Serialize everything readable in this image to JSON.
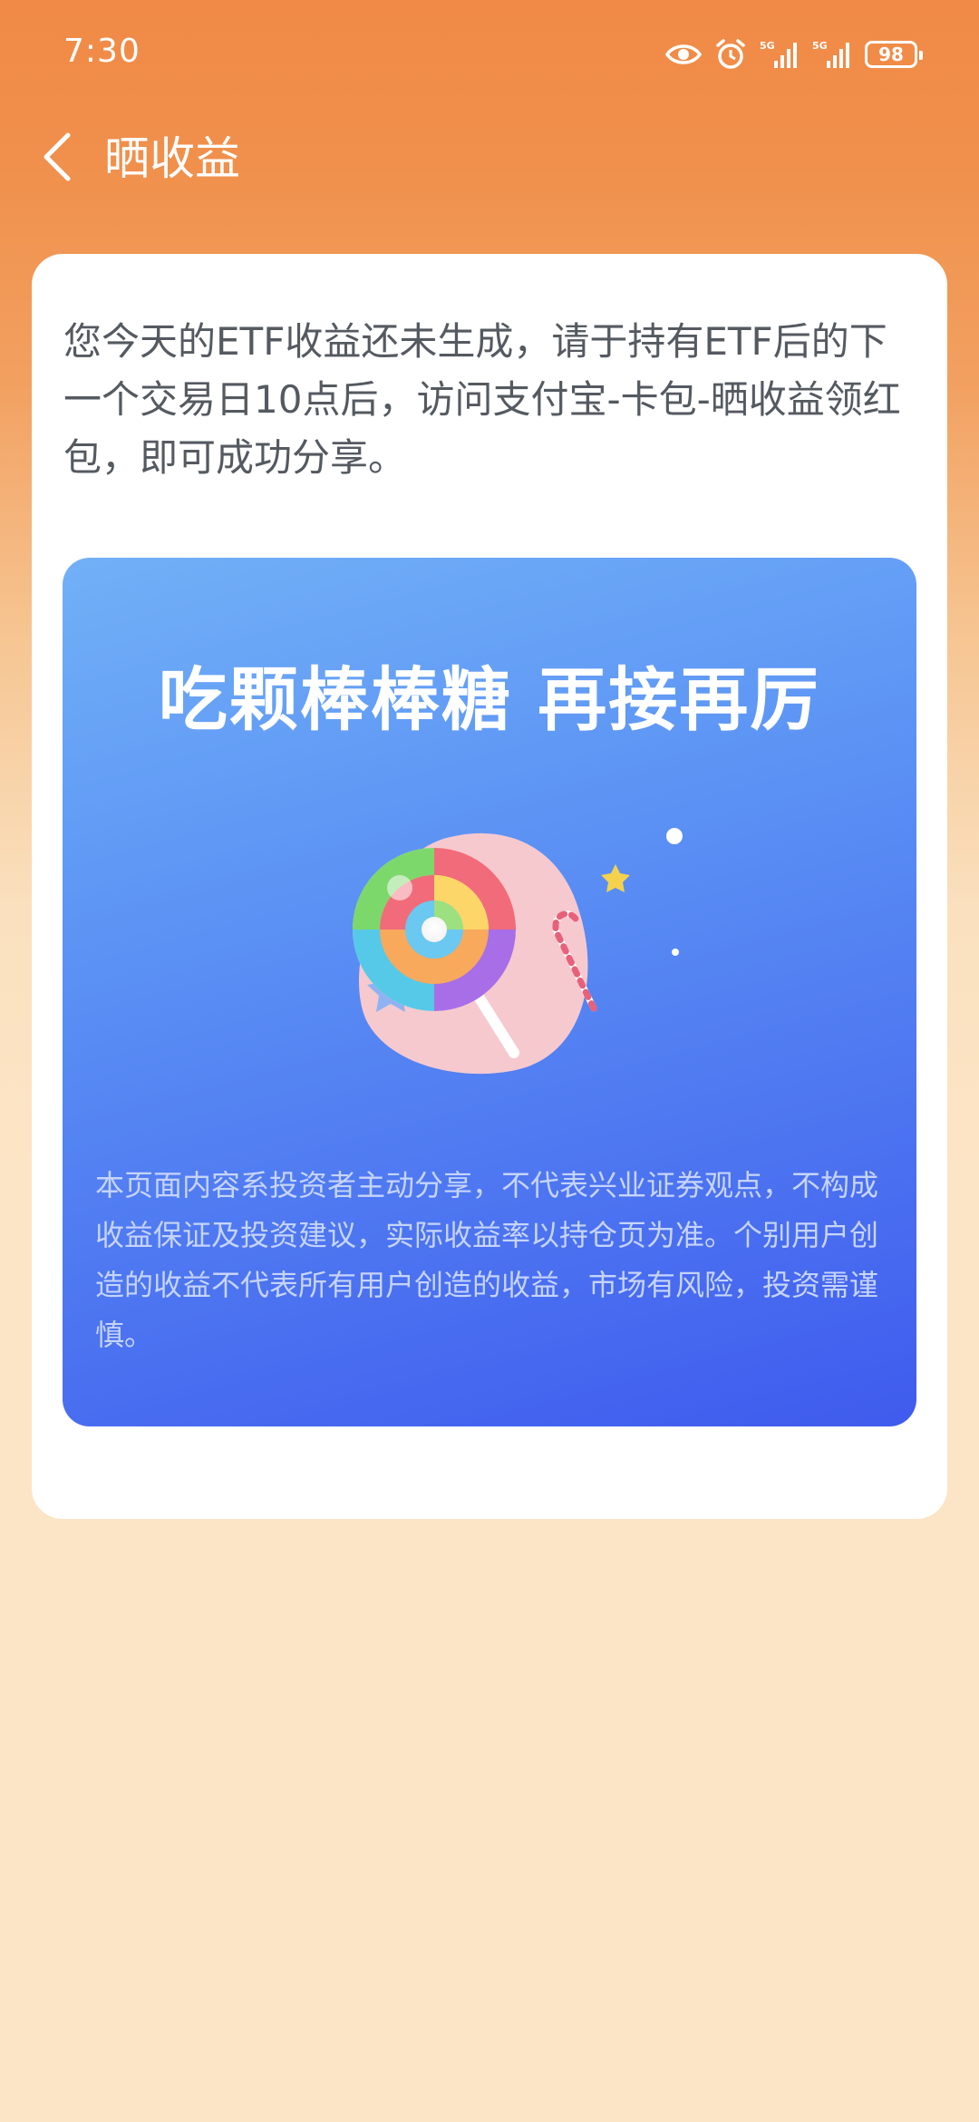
{
  "status_bar": {
    "time": "7:30",
    "battery": "98",
    "icons": [
      "eye-icon",
      "alarm-icon",
      "signal-5g-icon",
      "signal-5g-icon",
      "battery-icon"
    ]
  },
  "nav": {
    "back_icon": "chevron-left-icon",
    "title": "晒收益"
  },
  "card": {
    "notice": "您今天的ETF收益还未生成，请于持有ETF后的下一个交易日10点后，访问支付宝-卡包-晒收益领红包，即可成功分享。",
    "banner": {
      "title": "吃颗棒棒糖 再接再厉",
      "illustration": "lollipop-illustration",
      "disclaimer": "本页面内容系投资者主动分享，不代表兴业证券观点，不构成收益保证及投资建议，实际收益率以持仓页为准。个别用户创造的收益不代表所有用户创造的收益，市场有风险，投资需谨慎。"
    }
  },
  "colors": {
    "header_orange": "#F08A46",
    "page_cream": "#FCE5C6",
    "banner_blue_top": "#72B0F7",
    "banner_blue_bottom": "#3F5BEE"
  }
}
